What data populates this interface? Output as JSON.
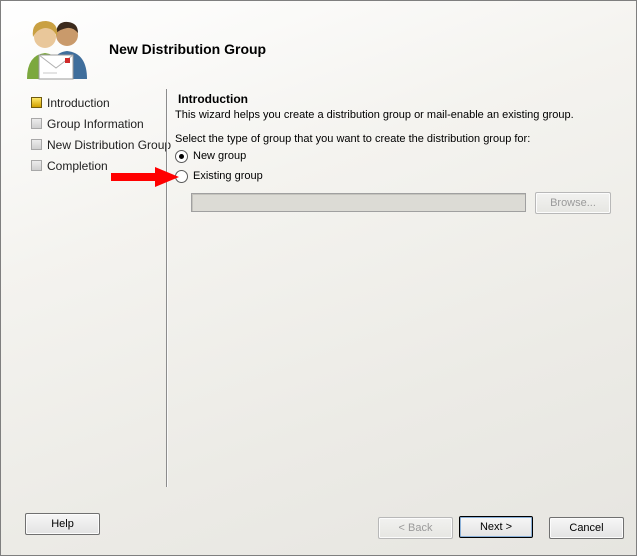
{
  "window": {
    "title": "New Distribution Group"
  },
  "steps": [
    {
      "label": "Introduction",
      "active": true
    },
    {
      "label": "Group Information",
      "active": false
    },
    {
      "label": "New Distribution Group",
      "active": false
    },
    {
      "label": "Completion",
      "active": false
    }
  ],
  "content": {
    "section_title": "Introduction",
    "intro_text": "This wizard helps you create a distribution group or mail-enable an existing group.",
    "select_prompt": "Select the type of group that you want to create the distribution group for:",
    "options": [
      {
        "label": "New group",
        "checked": true
      },
      {
        "label": "Existing group",
        "checked": false
      }
    ],
    "existing_group_value": "",
    "browse_label": "Browse..."
  },
  "buttons": {
    "help": "Help",
    "back": "< Back",
    "next": "Next >",
    "cancel": "Cancel"
  },
  "colors": {
    "annotation_arrow": "#ff0000",
    "active_step": "#e8c400"
  },
  "icons": {
    "header": "users-mail-icon",
    "annotation": "red-arrow-icon"
  }
}
